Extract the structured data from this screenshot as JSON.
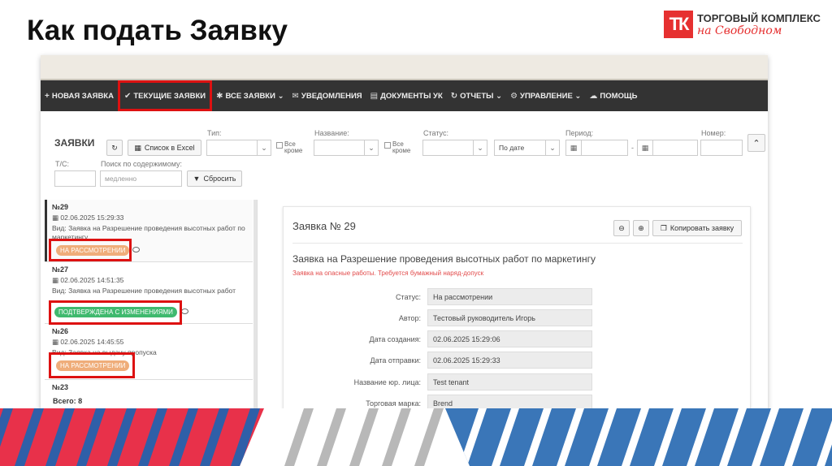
{
  "slide": {
    "title": "Как подать Заявку",
    "logo_mark": "ТК",
    "logo_name": "ТОРГОВЫЙ КОМПЛЕКС",
    "logo_sub": "на Свободном"
  },
  "navbar": {
    "items": [
      {
        "icon": "+",
        "label": "НОВАЯ ЗАЯВКА"
      },
      {
        "icon": "✔",
        "label": "ТЕКУЩИЕ ЗАЯВКИ"
      },
      {
        "icon": "✱",
        "label": "ВСЕ ЗАЯВКИ ⌄"
      },
      {
        "icon": "✉",
        "label": "УВЕДОМЛЕНИЯ"
      },
      {
        "icon": "▤",
        "label": "ДОКУМЕНТЫ УК"
      },
      {
        "icon": "↻",
        "label": "ОТЧЕТЫ ⌄"
      },
      {
        "icon": "⚙",
        "label": "УПРАВЛЕНИЕ ⌄"
      },
      {
        "icon": "☁",
        "label": "ПОМОЩЬ"
      }
    ]
  },
  "filters": {
    "panel_title": "ЗАЯВКИ",
    "excel_label": "Список в Excel",
    "type_label": "Тип:",
    "all_except": "Все кроме",
    "name_label": "Название:",
    "status_label": "Статус:",
    "sort_value": "По дате",
    "period_label": "Период:",
    "period_dash": "-",
    "number_label": "Номер:",
    "tc_label": "Т/С:",
    "search_label": "Поиск по содержимому:",
    "search_placeholder": "медленно",
    "reset_label": "Сбросить"
  },
  "list": {
    "items": [
      {
        "number": "№29",
        "date": "02.06.2025 15:29:33",
        "desc": "Вид: Заявка на Разрешение проведения высотных работ по маркетингу",
        "status": "НА РАССМОТРЕНИИ"
      },
      {
        "number": "№27",
        "date": "02.06.2025 14:51:35",
        "desc": "Вид: Заявка на Разрешение проведения высотных работ",
        "status": "ПОДТВЕРЖДЕНА С ИЗМЕНЕНИЯМИ"
      },
      {
        "number": "№26",
        "date": "02.06.2025 14:45:55",
        "desc": "Вид: Заявка на выдачу пропуска",
        "status": "НА РАССМОТРЕНИИ"
      },
      {
        "number": "№23"
      }
    ],
    "total": "Всего: 8"
  },
  "detail": {
    "title": "Заявка № 29",
    "copy_label": "Копировать заявку",
    "subject": "Заявка на Разрешение проведения высотных работ по маркетингу",
    "note": "Заявка на опасные работы. Требуется бумажный наряд-допуск",
    "fields": [
      {
        "label": "Статус:",
        "value": "На рассмотрении"
      },
      {
        "label": "Автор:",
        "value": "Тестовый руководитель Игорь"
      },
      {
        "label": "Дата создания:",
        "value": "02.06.2025 15:29:06"
      },
      {
        "label": "Дата отправки:",
        "value": "02.06.2025 15:29:33"
      },
      {
        "label": "Название юр. лица:",
        "value": "Test tenant"
      },
      {
        "label": "Торговая марка:",
        "value": "Brend"
      }
    ]
  },
  "colors": {
    "accent_red": "#e63030",
    "highlight_red": "#d11111",
    "stripe_blue": "#3a76b8",
    "navbar": "#333333",
    "badge_orange": "#efad7a",
    "badge_green": "#3fb96e"
  }
}
